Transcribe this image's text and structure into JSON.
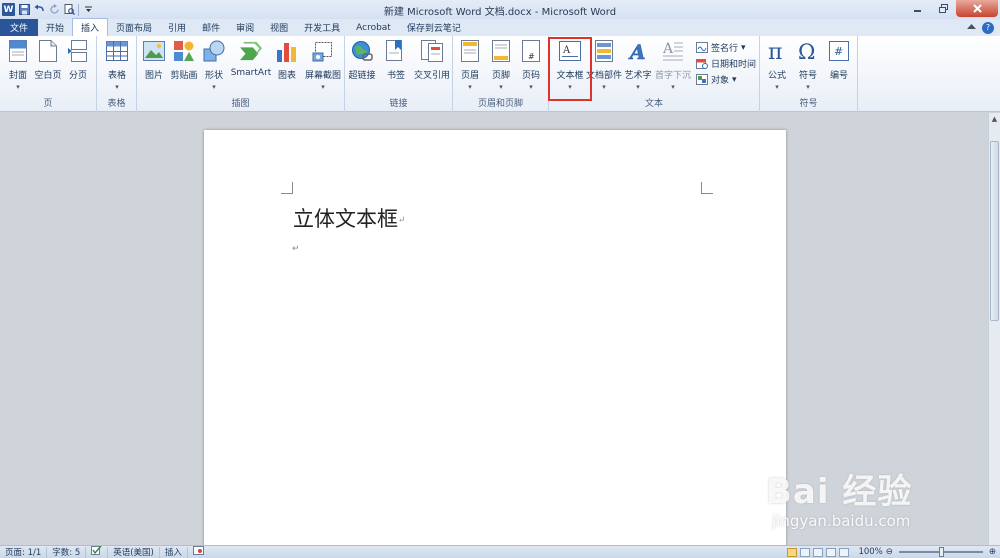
{
  "window": {
    "title": "新建 Microsoft Word 文档.docx - Microsoft Word",
    "app_icon": "W",
    "qat_icons": [
      "save-icon",
      "undo-icon",
      "redo-icon",
      "print-preview-icon",
      "customize-qat-icon"
    ]
  },
  "tabs": [
    {
      "label": "文件",
      "active": false
    },
    {
      "label": "开始",
      "active": false
    },
    {
      "label": "插入",
      "active": true
    },
    {
      "label": "页面布局",
      "active": false
    },
    {
      "label": "引用",
      "active": false
    },
    {
      "label": "邮件",
      "active": false
    },
    {
      "label": "审阅",
      "active": false
    },
    {
      "label": "视图",
      "active": false
    },
    {
      "label": "开发工具",
      "active": false
    },
    {
      "label": "Acrobat",
      "active": false
    },
    {
      "label": "保存到云笔记",
      "active": false
    }
  ],
  "ribbon": {
    "groups": {
      "pages": "页",
      "tables": "表格",
      "illustrations": "插图",
      "links": "链接",
      "header_footer": "页眉和页脚",
      "text": "文本",
      "symbols": "符号"
    },
    "buttons": {
      "cover": "封面",
      "blank_page": "空白页",
      "page_break": "分页",
      "table": "表格",
      "picture": "图片",
      "clip_art": "剪贴画",
      "shapes": "形状",
      "smartart": "SmartArt",
      "chart": "图表",
      "screenshot": "屏幕截图",
      "hyperlink": "超链接",
      "bookmark": "书签",
      "cross_ref": "交叉引用",
      "header": "页眉",
      "footer": "页脚",
      "page_number": "页码",
      "text_box": "文本框",
      "quick_parts": "文档部件",
      "wordart": "艺术字",
      "drop_cap": "首字下沉",
      "signature_line": "签名行",
      "date_time": "日期和时间",
      "object": "对象",
      "equation": "公式",
      "symbol": "符号",
      "numbering": "编号"
    }
  },
  "document": {
    "text": "立体文本框",
    "para_mark": "↵"
  },
  "status": {
    "page": "页面: 1/1",
    "words": "字数: 5",
    "language": "英语(美国)",
    "mode": "插入",
    "zoom": "100%"
  },
  "watermark": {
    "logo": "Bai 经验",
    "url": "jingyan.baidu.com"
  },
  "colors": {
    "file_tab": "#2a5699",
    "highlight": "#e0322d",
    "close_button": "#c7442f"
  }
}
